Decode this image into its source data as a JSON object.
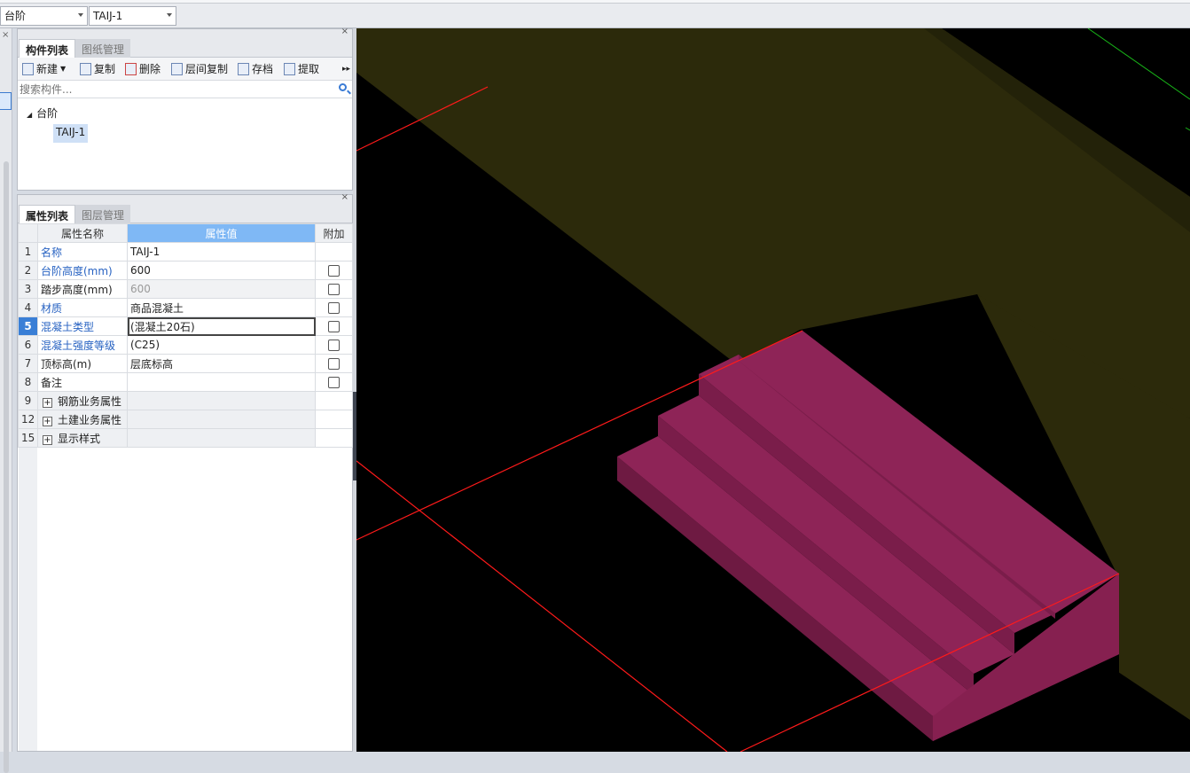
{
  "topbar": {
    "combo_category": "台阶",
    "combo_component": "TAIJ-1"
  },
  "component_panel": {
    "tabs": [
      "构件列表",
      "图纸管理"
    ],
    "toolbar": [
      {
        "label": "新建",
        "icon": "new-file-icon"
      },
      {
        "label": "复制",
        "icon": "copy-icon"
      },
      {
        "label": "删除",
        "icon": "delete-icon"
      },
      {
        "label": "层间复制",
        "icon": "floor-copy-icon"
      },
      {
        "label": "存档",
        "icon": "archive-icon"
      },
      {
        "label": "提取",
        "icon": "extract-icon"
      }
    ],
    "search_placeholder": "搜索构件...",
    "tree": {
      "root": "台阶",
      "leaf": "TAIJ-1"
    }
  },
  "property_panel": {
    "tabs": [
      "属性列表",
      "图层管理"
    ],
    "headers": {
      "name": "属性名称",
      "value": "属性值",
      "extra": "附加"
    },
    "rows": [
      {
        "num": "1",
        "name": "名称",
        "value": "TAIJ-1",
        "blue": true,
        "checkbox": false
      },
      {
        "num": "2",
        "name": "台阶高度(mm)",
        "value": "600",
        "blue": true,
        "checkbox": true
      },
      {
        "num": "3",
        "name": "踏步高度(mm)",
        "value": "600",
        "blue": false,
        "checkbox": true,
        "grey": true
      },
      {
        "num": "4",
        "name": "材质",
        "value": "商品混凝土",
        "blue": true,
        "checkbox": true
      },
      {
        "num": "5",
        "name": "混凝土类型",
        "value": "(混凝土20石)",
        "blue": true,
        "checkbox": true,
        "selected": true
      },
      {
        "num": "6",
        "name": "混凝土强度等级",
        "value": "(C25)",
        "blue": true,
        "checkbox": true
      },
      {
        "num": "7",
        "name": "顶标高(m)",
        "value": "层底标高",
        "blue": false,
        "checkbox": true
      },
      {
        "num": "8",
        "name": "备注",
        "value": "",
        "blue": false,
        "checkbox": true
      },
      {
        "num": "9",
        "name": "钢筋业务属性",
        "group": true
      },
      {
        "num": "12",
        "name": "土建业务属性",
        "group": true
      },
      {
        "num": "15",
        "name": "显示样式",
        "group": true
      }
    ]
  },
  "viewport": {
    "colors": {
      "background": "#000000",
      "wall_top": "#2c2a0b",
      "wall_side": "#232209",
      "stair_face": "#862050",
      "stair_side": "#6e1a42",
      "stair_top": "#8e2457",
      "red_line": "#ff1a1a",
      "green_line": "#18b418"
    }
  }
}
